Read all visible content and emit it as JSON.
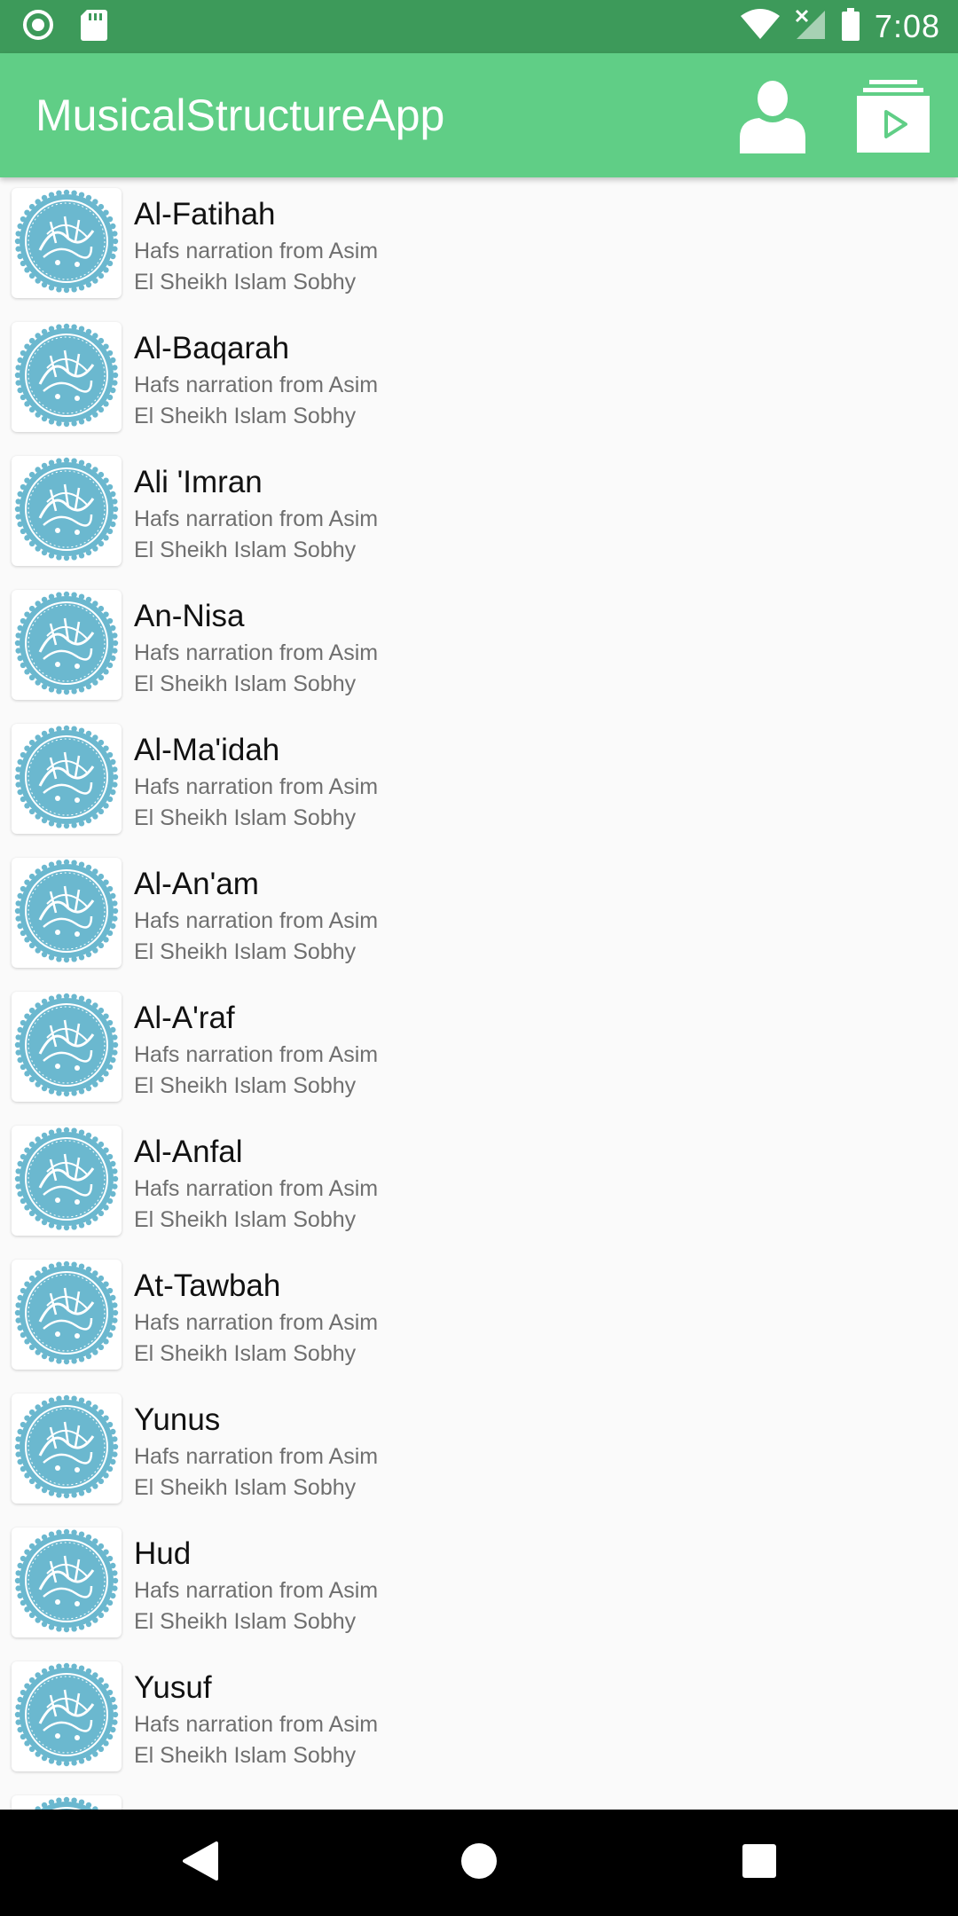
{
  "status_bar": {
    "time": "7:08",
    "left_icons": [
      "circle-notification-icon",
      "sd-card-icon"
    ],
    "right_icons": [
      "wifi-icon",
      "cell-signal-off-icon",
      "battery-icon"
    ]
  },
  "app_bar": {
    "title": "MusicalStructureApp",
    "actions": [
      "person-icon",
      "playlist-play-icon"
    ],
    "color": "#60ce86",
    "status_color": "#3d9a5a"
  },
  "list": {
    "thumbnail_icon": "quran-seal-icon",
    "thumbnail_color": "#6bb8cf",
    "items": [
      {
        "title": "Al-Fatihah",
        "line1": "Hafs narration from Asim",
        "line2": "El Sheikh Islam Sobhy"
      },
      {
        "title": "Al-Baqarah",
        "line1": "Hafs narration from Asim",
        "line2": "El Sheikh Islam Sobhy"
      },
      {
        "title": "Ali 'Imran",
        "line1": "Hafs narration from Asim",
        "line2": "El Sheikh Islam Sobhy"
      },
      {
        "title": "An-Nisa",
        "line1": "Hafs narration from Asim",
        "line2": "El Sheikh Islam Sobhy"
      },
      {
        "title": "Al-Ma'idah",
        "line1": "Hafs narration from Asim",
        "line2": "El Sheikh Islam Sobhy"
      },
      {
        "title": "Al-An'am",
        "line1": "Hafs narration from Asim",
        "line2": "El Sheikh Islam Sobhy"
      },
      {
        "title": "Al-A'raf",
        "line1": "Hafs narration from Asim",
        "line2": "El Sheikh Islam Sobhy"
      },
      {
        "title": "Al-Anfal",
        "line1": "Hafs narration from Asim",
        "line2": "El Sheikh Islam Sobhy"
      },
      {
        "title": "At-Tawbah",
        "line1": "Hafs narration from Asim",
        "line2": "El Sheikh Islam Sobhy"
      },
      {
        "title": "Yunus",
        "line1": "Hafs narration from Asim",
        "line2": "El Sheikh Islam Sobhy"
      },
      {
        "title": "Hud",
        "line1": "Hafs narration from Asim",
        "line2": "El Sheikh Islam Sobhy"
      },
      {
        "title": "Yusuf",
        "line1": "Hafs narration from Asim",
        "line2": "El Sheikh Islam Sobhy"
      },
      {
        "title": "",
        "line1": "",
        "line2": ""
      }
    ]
  },
  "nav_bar": {
    "buttons": [
      "back-icon",
      "home-icon",
      "recents-icon"
    ]
  }
}
